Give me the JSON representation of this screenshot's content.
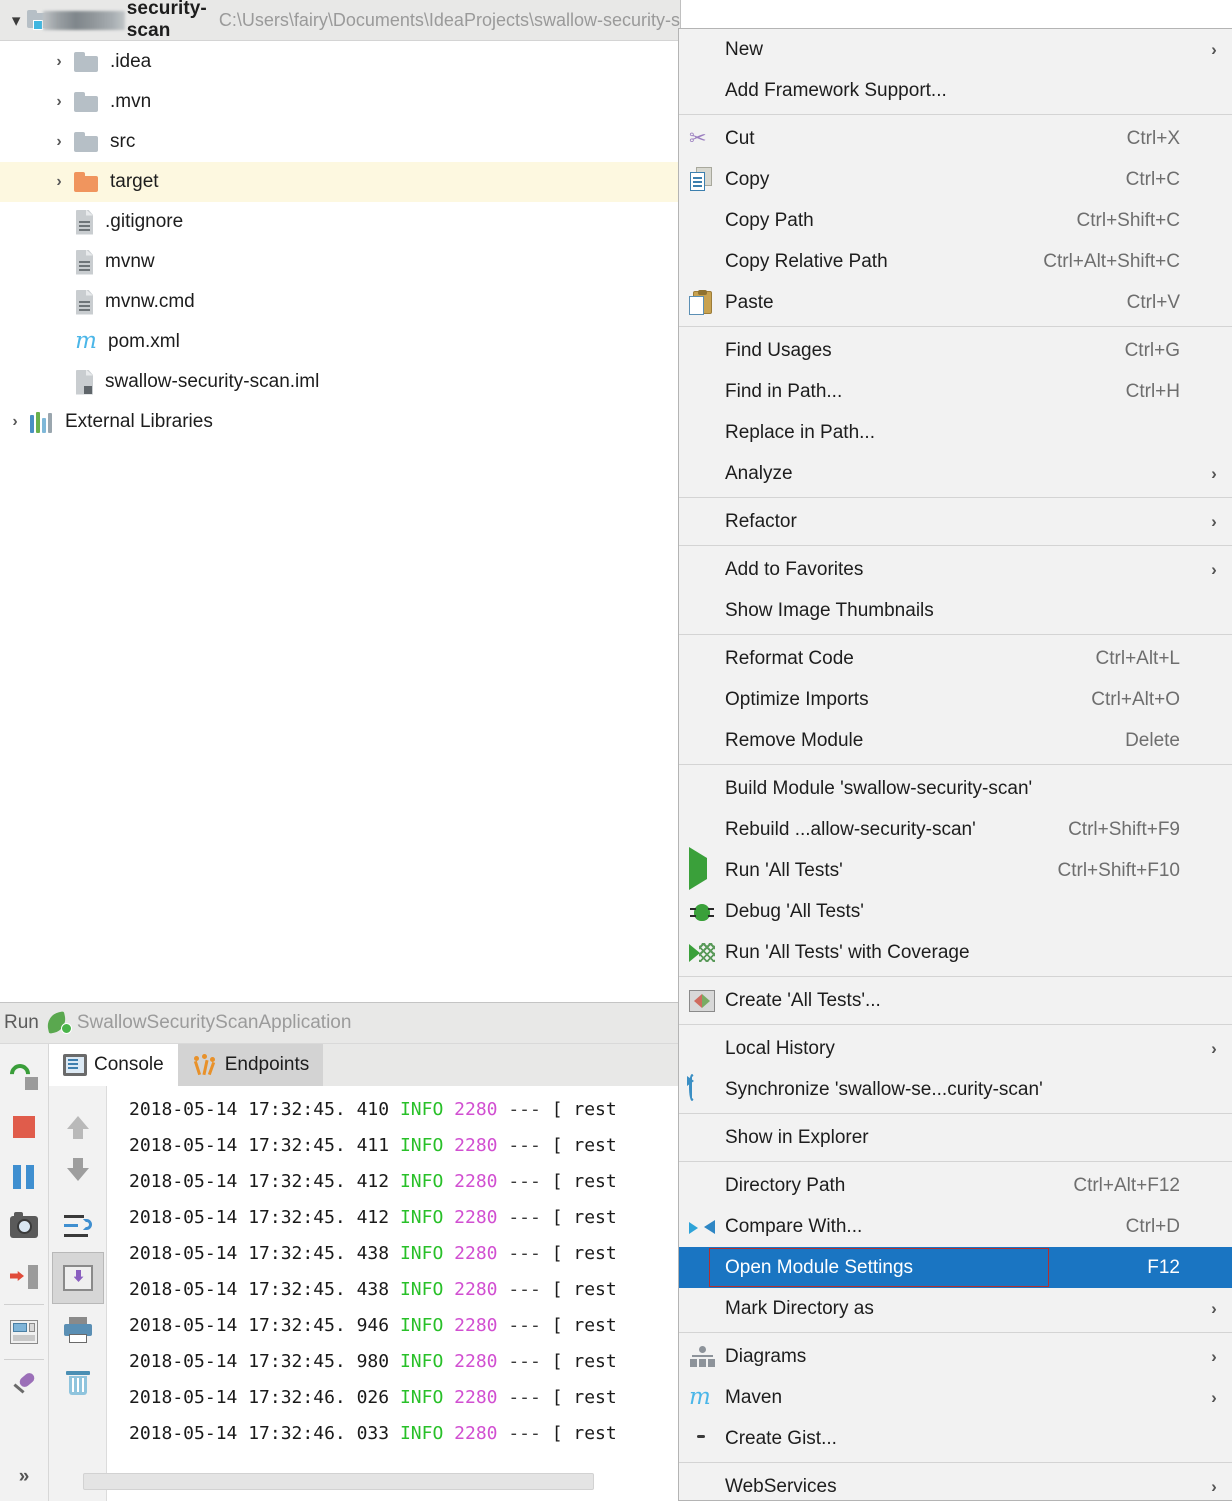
{
  "project": {
    "header": {
      "expand_icon": "chevron-down-icon",
      "redacted_prefix": "sw",
      "name": "security-scan",
      "path": "C:\\Users\\fairy\\Documents\\IdeaProjects\\swallow-security-s"
    },
    "tree": [
      {
        "label": ".idea",
        "icon": "folder-icon",
        "expandable": true,
        "level": 1,
        "selected": false
      },
      {
        "label": ".mvn",
        "icon": "folder-icon",
        "expandable": true,
        "level": 1,
        "selected": false
      },
      {
        "label": "src",
        "icon": "folder-icon",
        "expandable": true,
        "level": 1,
        "selected": false
      },
      {
        "label": "target",
        "icon": "folder-orange-icon",
        "expandable": true,
        "level": 1,
        "selected": true
      },
      {
        "label": ".gitignore",
        "icon": "file-icon",
        "expandable": false,
        "level": 2,
        "selected": false
      },
      {
        "label": "mvnw",
        "icon": "file-icon",
        "expandable": false,
        "level": 2,
        "selected": false
      },
      {
        "label": "mvnw.cmd",
        "icon": "file-icon",
        "expandable": false,
        "level": 2,
        "selected": false
      },
      {
        "label": "pom.xml",
        "icon": "maven-icon",
        "expandable": false,
        "level": 2,
        "selected": false
      },
      {
        "label": "swallow-security-scan.iml",
        "icon": "iml-file-icon",
        "expandable": false,
        "level": 2,
        "selected": false
      },
      {
        "label": "External Libraries",
        "icon": "library-icon",
        "expandable": true,
        "level": 0,
        "selected": false
      }
    ]
  },
  "run_panel": {
    "title": "Run",
    "config_name": "SwallowSecurityScanApplication",
    "tabs": [
      {
        "label": "Console",
        "icon": "console-icon",
        "active": true
      },
      {
        "label": "Endpoints",
        "icon": "endpoints-icon",
        "active": false
      }
    ],
    "toolbar_left": [
      {
        "name": "rerun-button"
      },
      {
        "name": "stop-button"
      },
      {
        "name": "pause-button"
      },
      {
        "name": "screenshot-button"
      },
      {
        "name": "exit-button"
      },
      {
        "name": "layout-button"
      },
      {
        "name": "pin-button"
      },
      {
        "name": "more-button",
        "label": "»"
      }
    ],
    "toolbar_console": [
      {
        "name": "up-arrow-button"
      },
      {
        "name": "down-arrow-button"
      },
      {
        "name": "soft-wrap-button"
      },
      {
        "name": "scroll-to-end-button",
        "pressed": true
      },
      {
        "name": "print-button"
      },
      {
        "name": "clear-all-button"
      }
    ],
    "log_lines": [
      {
        "date": "2018-05-14",
        "time": "17:32:45.",
        "ms": "410",
        "level": "INFO",
        "pid": "2280",
        "dash": "---",
        "tail": "[  rest"
      },
      {
        "date": "2018-05-14",
        "time": "17:32:45.",
        "ms": "411",
        "level": "INFO",
        "pid": "2280",
        "dash": "---",
        "tail": "[  rest"
      },
      {
        "date": "2018-05-14",
        "time": "17:32:45.",
        "ms": "412",
        "level": "INFO",
        "pid": "2280",
        "dash": "---",
        "tail": "[  rest"
      },
      {
        "date": "2018-05-14",
        "time": "17:32:45.",
        "ms": "412",
        "level": "INFO",
        "pid": "2280",
        "dash": "---",
        "tail": "[  rest"
      },
      {
        "date": "2018-05-14",
        "time": "17:32:45.",
        "ms": "438",
        "level": "INFO",
        "pid": "2280",
        "dash": "---",
        "tail": "[  rest"
      },
      {
        "date": "2018-05-14",
        "time": "17:32:45.",
        "ms": "438",
        "level": "INFO",
        "pid": "2280",
        "dash": "---",
        "tail": "[  rest"
      },
      {
        "date": "2018-05-14",
        "time": "17:32:45.",
        "ms": "946",
        "level": "INFO",
        "pid": "2280",
        "dash": "---",
        "tail": "[  rest"
      },
      {
        "date": "2018-05-14",
        "time": "17:32:45.",
        "ms": "980",
        "level": "INFO",
        "pid": "2280",
        "dash": "---",
        "tail": "[  rest"
      },
      {
        "date": "2018-05-14",
        "time": "17:32:46.",
        "ms": "026",
        "level": "INFO",
        "pid": "2280",
        "dash": "---",
        "tail": "[  rest"
      },
      {
        "date": "2018-05-14",
        "time": "17:32:46.",
        "ms": "033",
        "level": "INFO",
        "pid": "2280",
        "dash": "---",
        "tail": "[  rest"
      }
    ],
    "collapse_label": "»"
  },
  "context_menu": {
    "highlight_color": "#1a75c2",
    "annotation_color": "#b03030",
    "items": [
      {
        "label": "New",
        "icon": null,
        "accel": "",
        "submenu": true
      },
      {
        "label": "Add Framework Support...",
        "icon": null,
        "accel": "",
        "submenu": false
      },
      {
        "separator": true
      },
      {
        "label": "Cut",
        "icon": "scissors-icon",
        "accel": "Ctrl+X",
        "submenu": false
      },
      {
        "label": "Copy",
        "icon": "copy-icon",
        "accel": "Ctrl+C",
        "submenu": false
      },
      {
        "label": "Copy Path",
        "icon": null,
        "accel": "Ctrl+Shift+C",
        "submenu": false
      },
      {
        "label": "Copy Relative Path",
        "icon": null,
        "accel": "Ctrl+Alt+Shift+C",
        "submenu": false
      },
      {
        "label": "Paste",
        "icon": "paste-icon",
        "accel": "Ctrl+V",
        "submenu": false
      },
      {
        "separator": true
      },
      {
        "label": "Find Usages",
        "icon": null,
        "accel": "Ctrl+G",
        "submenu": false
      },
      {
        "label": "Find in Path...",
        "icon": null,
        "accel": "Ctrl+H",
        "submenu": false
      },
      {
        "label": "Replace in Path...",
        "icon": null,
        "accel": "",
        "submenu": false
      },
      {
        "label": "Analyze",
        "icon": null,
        "accel": "",
        "submenu": true
      },
      {
        "separator": true
      },
      {
        "label": "Refactor",
        "icon": null,
        "accel": "",
        "submenu": true
      },
      {
        "separator": true
      },
      {
        "label": "Add to Favorites",
        "icon": null,
        "accel": "",
        "submenu": true
      },
      {
        "label": "Show Image Thumbnails",
        "icon": null,
        "accel": "",
        "submenu": false
      },
      {
        "separator": true
      },
      {
        "label": "Reformat Code",
        "icon": null,
        "accel": "Ctrl+Alt+L",
        "submenu": false
      },
      {
        "label": "Optimize Imports",
        "icon": null,
        "accel": "Ctrl+Alt+O",
        "submenu": false
      },
      {
        "label": "Remove Module",
        "icon": null,
        "accel": "Delete",
        "submenu": false
      },
      {
        "separator": true
      },
      {
        "label": "Build Module 'swallow-security-scan'",
        "icon": null,
        "accel": "",
        "submenu": false
      },
      {
        "label": "Rebuild ...allow-security-scan'",
        "icon": null,
        "accel": "Ctrl+Shift+F9",
        "submenu": false
      },
      {
        "label": "Run 'All Tests'",
        "icon": "run-icon",
        "accel": "Ctrl+Shift+F10",
        "submenu": false
      },
      {
        "label": "Debug 'All Tests'",
        "icon": "debug-icon",
        "accel": "",
        "submenu": false
      },
      {
        "label": "Run 'All Tests' with Coverage",
        "icon": "coverage-icon",
        "accel": "",
        "submenu": false
      },
      {
        "separator": true
      },
      {
        "label": "Create 'All Tests'...",
        "icon": "create-config-icon",
        "accel": "",
        "submenu": false
      },
      {
        "separator": true
      },
      {
        "label": "Local History",
        "icon": null,
        "accel": "",
        "submenu": true
      },
      {
        "label": "Synchronize 'swallow-se...curity-scan'",
        "icon": "sync-icon",
        "accel": "",
        "submenu": false
      },
      {
        "separator": true
      },
      {
        "label": "Show in Explorer",
        "icon": null,
        "accel": "",
        "submenu": false
      },
      {
        "separator": true
      },
      {
        "label": "Directory Path",
        "icon": null,
        "accel": "Ctrl+Alt+F12",
        "submenu": false
      },
      {
        "label": "Compare With...",
        "icon": "compare-icon",
        "accel": "Ctrl+D",
        "submenu": false
      },
      {
        "label": "Open Module Settings",
        "icon": null,
        "accel": "F12",
        "submenu": false,
        "highlighted": true,
        "annotated": true
      },
      {
        "label": "Mark Directory as",
        "icon": null,
        "accel": "",
        "submenu": true
      },
      {
        "separator": true
      },
      {
        "label": "Diagrams",
        "icon": "diagram-icon",
        "accel": "",
        "submenu": true
      },
      {
        "label": "Maven",
        "icon": "maven-icon",
        "accel": "",
        "submenu": true
      },
      {
        "label": "Create Gist...",
        "icon": "github-icon",
        "accel": "",
        "submenu": false
      },
      {
        "separator": true
      },
      {
        "label": "WebServices",
        "icon": null,
        "accel": "",
        "submenu": true
      }
    ]
  }
}
